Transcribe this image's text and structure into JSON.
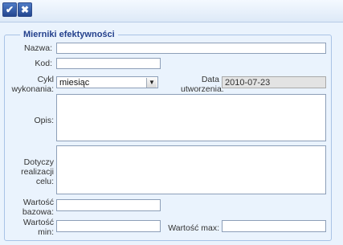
{
  "toolbar": {
    "ok_icon": "✔",
    "cancel_icon": "✖"
  },
  "section": {
    "title": "Mierniki efektywności"
  },
  "fields": {
    "nazwa": {
      "label": "Nazwa:",
      "value": ""
    },
    "kod": {
      "label": "Kod:",
      "value": ""
    },
    "cykl": {
      "label_line1": "Cykl",
      "label_line2": "wykonania:",
      "value": "miesiąc"
    },
    "data_utworzenia": {
      "label_line1": "Data",
      "label_line2": "utworzenia:",
      "value": "2010-07-23"
    },
    "opis": {
      "label": "Opis:",
      "value": ""
    },
    "dotyczy": {
      "label_line1": "Dotyczy",
      "label_line2": "realizacji",
      "label_line3": "celu:",
      "value": ""
    },
    "wartosc_bazowa": {
      "label_line1": "Wartość",
      "label_line2": "bazowa:",
      "value": ""
    },
    "wartosc_min": {
      "label_line1": "Wartość",
      "label_line2": "min:",
      "value": ""
    },
    "wartosc_max": {
      "label": "Wartość max:",
      "value": ""
    }
  }
}
